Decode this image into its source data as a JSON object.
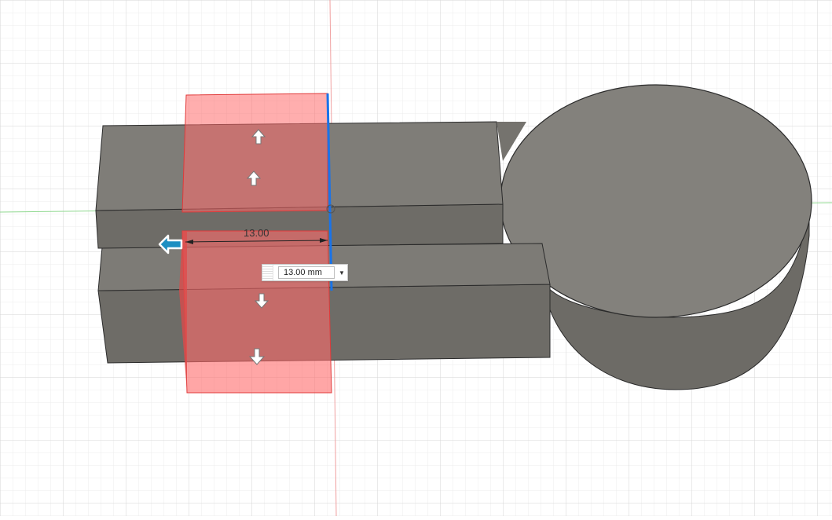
{
  "dimension": {
    "label": "13.00",
    "input_value": "13.00 mm"
  },
  "icons": {
    "move_up": "arrow-up-icon",
    "move_down": "arrow-down-icon",
    "move_left": "arrow-left-icon",
    "dropdown": "chevron-down-icon"
  },
  "colors": {
    "background": "#ffffff",
    "grid_minor": "#e9e9e9",
    "grid_major": "#d3d3d3",
    "body_face": "#75736e",
    "body_top": "#86847f",
    "body_edge": "#2b2b2b",
    "preview_fill": "#ff6b6b",
    "preview_edge": "#e03a3a",
    "selected_edge": "#1a73e8",
    "x_axis": "#7bd07b",
    "y_axis": "#e88a8a",
    "manipulator": "#1e8fc2"
  }
}
